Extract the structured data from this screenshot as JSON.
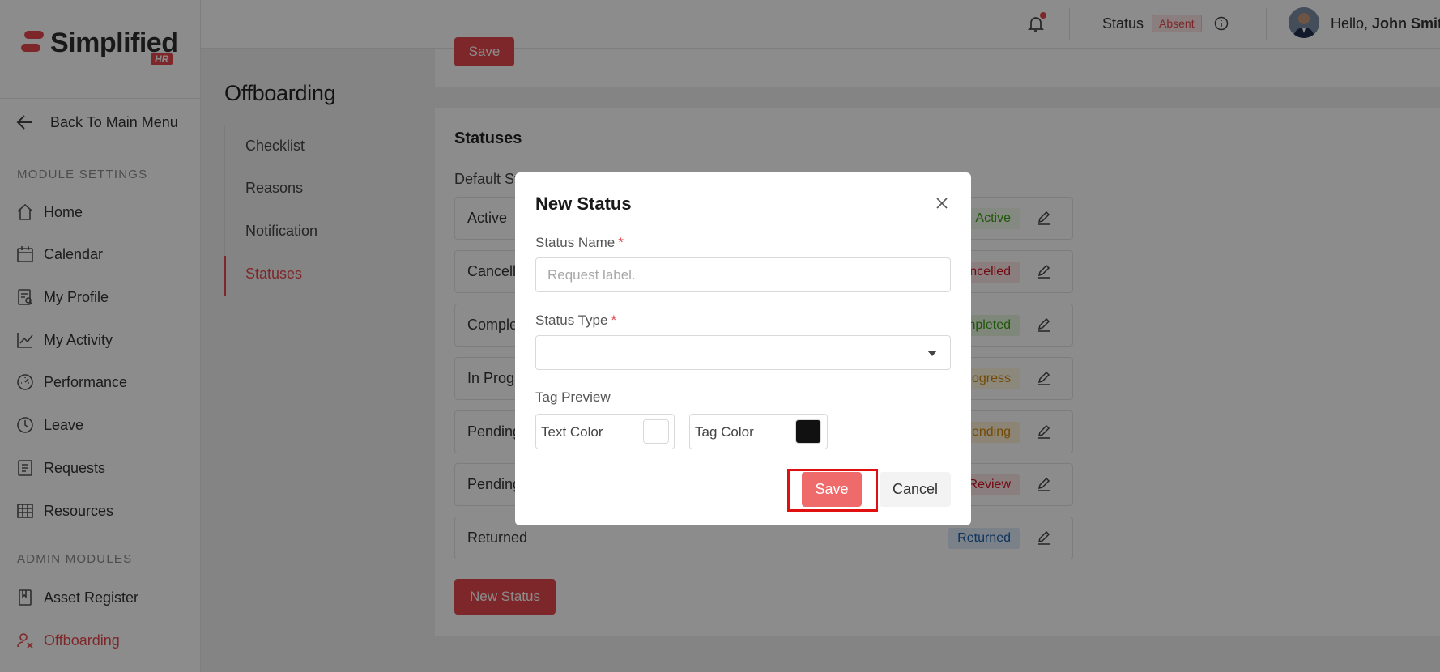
{
  "brand": {
    "name": "Simplified",
    "sub": "HR"
  },
  "sidebar": {
    "back_label": "Back To Main Menu",
    "module_heading": "MODULE SETTINGS",
    "module_items": [
      {
        "label": "Home",
        "icon": "home-icon"
      },
      {
        "label": "Calendar",
        "icon": "calendar-icon"
      },
      {
        "label": "My Profile",
        "icon": "profile-icon"
      },
      {
        "label": "My Activity",
        "icon": "activity-icon"
      },
      {
        "label": "Performance",
        "icon": "performance-icon"
      },
      {
        "label": "Leave",
        "icon": "clock-icon"
      },
      {
        "label": "Requests",
        "icon": "requests-icon"
      },
      {
        "label": "Resources",
        "icon": "table-icon"
      }
    ],
    "admin_heading": "ADMIN MODULES",
    "admin_items": [
      {
        "label": "Asset Register",
        "icon": "book-icon"
      },
      {
        "label": "Offboarding",
        "icon": "offboarding-icon",
        "active": true
      }
    ]
  },
  "header": {
    "status_label": "Status",
    "status_value": "Absent",
    "greeting": "Hello,",
    "user_name": "John Smith"
  },
  "page": {
    "title": "Offboarding",
    "subnav": [
      "Checklist",
      "Reasons",
      "Notification",
      "Statuses"
    ],
    "active_subnav": "Statuses"
  },
  "panel": {
    "top_save_label": "Save",
    "title": "Statuses",
    "default_label": "Default St",
    "rows": [
      {
        "name": "Active",
        "tag": "Active",
        "tag_color": "#389e0d",
        "tag_bg": "#f0f9eb"
      },
      {
        "name": "Cancell",
        "tag": "ncelled",
        "tag_color": "#cf1322",
        "tag_bg": "#fde6e6"
      },
      {
        "name": "Comple",
        "tag": "mpleted",
        "tag_color": "#389e0d",
        "tag_bg": "#e8f6e1"
      },
      {
        "name": "In Progr",
        "tag": "ogress",
        "tag_color": "#d48806",
        "tag_bg": "#fff7e0"
      },
      {
        "name": "Pending",
        "tag": "ending",
        "tag_color": "#d48806",
        "tag_bg": "#fff3d6"
      },
      {
        "name": "Pending",
        "tag": "Review",
        "tag_color": "#cf1322",
        "tag_bg": "#fde6e6"
      },
      {
        "name": "Returned",
        "tag": "Returned",
        "tag_color": "#1d5ea8",
        "tag_bg": "#e0ecfa"
      }
    ],
    "new_status_label": "New Status"
  },
  "modal": {
    "title": "New Status",
    "status_name_label": "Status Name",
    "status_name_placeholder": "Request label.",
    "status_name_value": "",
    "status_type_label": "Status Type",
    "status_type_value": "",
    "tag_preview_label": "Tag Preview",
    "text_color_label": "Text Color",
    "text_color": "#ffffff",
    "tag_color_label": "Tag Color",
    "tag_color": "#111111",
    "save_label": "Save",
    "cancel_label": "Cancel"
  },
  "colors": {
    "accent": "#e5484d"
  }
}
